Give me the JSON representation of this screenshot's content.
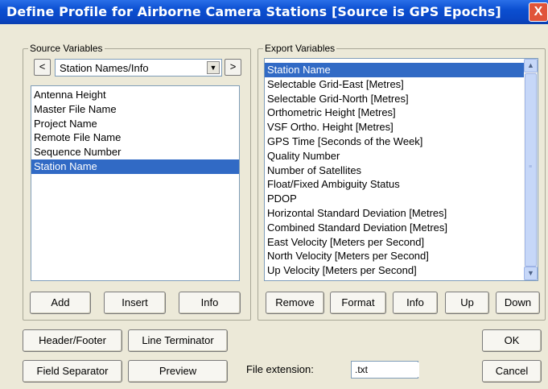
{
  "window": {
    "title": "Define Profile for Airborne Camera Stations [Source is GPS Epochs]",
    "close_glyph": "X"
  },
  "source": {
    "legend": "Source Variables",
    "prev_glyph": "<",
    "next_glyph": ">",
    "combo_value": "Station Names/Info",
    "items": [
      "Antenna Height",
      "Master File Name",
      "Project Name",
      "Remote File Name",
      "Sequence Number",
      "Station Name"
    ],
    "selected_index": 5,
    "buttons": {
      "add": "Add",
      "insert": "Insert",
      "info": "Info"
    }
  },
  "export": {
    "legend": "Export Variables",
    "items": [
      "Station Name",
      "Selectable Grid-East [Metres]",
      "Selectable Grid-North [Metres]",
      "Orthometric Height [Metres]",
      "VSF Ortho. Height [Metres]",
      "GPS Time [Seconds of the Week]",
      "Quality Number",
      "Number of Satellites",
      "Float/Fixed Ambiguity Status",
      "PDOP",
      "Horizontal Standard Deviation [Metres]",
      "Combined Standard Deviation [Metres]",
      "East Velocity [Meters per Second]",
      "North Velocity [Meters per Second]",
      "Up Velocity [Meters per Second]"
    ],
    "selected_index": 0,
    "buttons": {
      "remove": "Remove",
      "format": "Format",
      "info": "Info",
      "up": "Up",
      "down": "Down"
    }
  },
  "bottom": {
    "header_footer": "Header/Footer",
    "line_terminator": "Line Terminator",
    "field_separator": "Field Separator",
    "preview": "Preview",
    "file_ext_label": "File extension:",
    "file_ext_value": ".txt",
    "ok": "OK",
    "cancel": "Cancel"
  }
}
